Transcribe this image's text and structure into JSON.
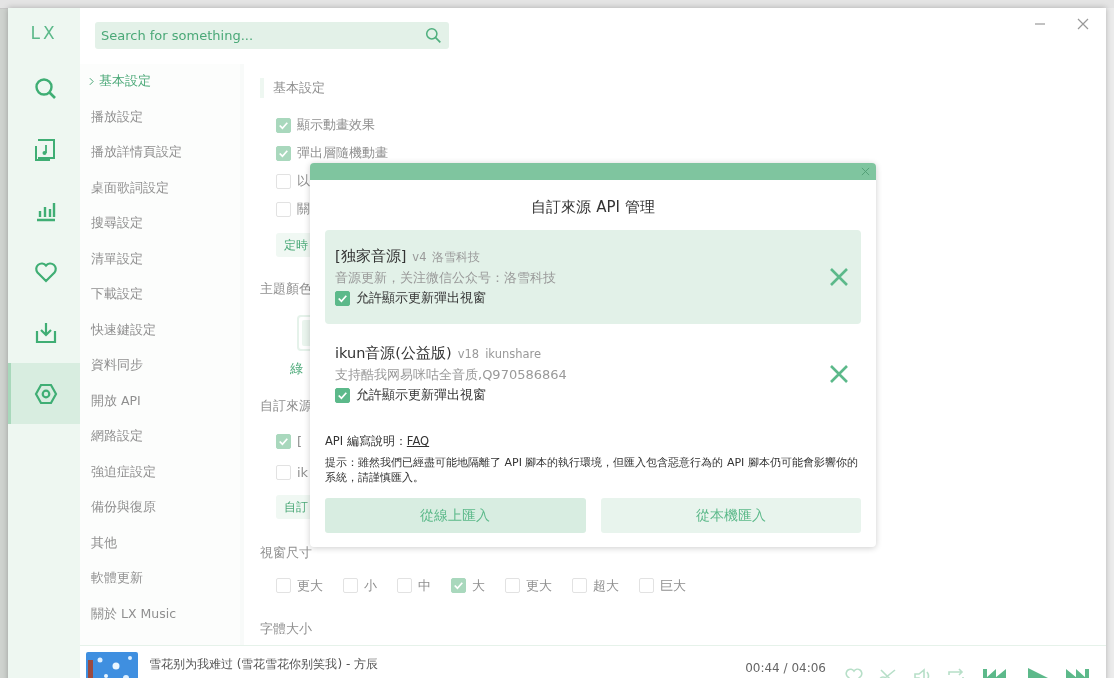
{
  "app": {
    "logo": "LX"
  },
  "sidebar": {
    "items": [
      {
        "selected": false
      },
      {
        "selected": false
      },
      {
        "selected": false
      },
      {
        "selected": false
      },
      {
        "selected": false
      },
      {
        "selected": true
      }
    ]
  },
  "search": {
    "placeholder": "Search for something..."
  },
  "settings_nav": {
    "items": [
      {
        "label": "基本設定",
        "selected": true
      },
      {
        "label": "播放設定",
        "selected": false
      },
      {
        "label": "播放詳情頁設定",
        "selected": false
      },
      {
        "label": "桌面歌詞設定",
        "selected": false
      },
      {
        "label": "搜尋設定",
        "selected": false
      },
      {
        "label": "清單設定",
        "selected": false
      },
      {
        "label": "下載設定",
        "selected": false
      },
      {
        "label": "快速鍵設定",
        "selected": false
      },
      {
        "label": "資料同步",
        "selected": false
      },
      {
        "label": "開放 API",
        "selected": false
      },
      {
        "label": "網路設定",
        "selected": false
      },
      {
        "label": "強迫症設定",
        "selected": false
      },
      {
        "label": "備份與復原",
        "selected": false
      },
      {
        "label": "其他",
        "selected": false
      },
      {
        "label": "軟體更新",
        "selected": false
      },
      {
        "label": "關於 LX Music",
        "selected": false
      }
    ]
  },
  "settings": {
    "heading": "基本設定",
    "basic_options": [
      {
        "label": "顯示動畫效果",
        "checked": true
      },
      {
        "label": "彈出層隨機動畫",
        "checked": true
      },
      {
        "label": "以",
        "checked": false
      },
      {
        "label": "關",
        "checked": false
      }
    ],
    "timer_button": "定時",
    "theme_label": "主題顏色",
    "theme_swatch_label": "綠",
    "custom_source_label": "自訂來源",
    "custom_sources": [
      {
        "label": "[",
        "checked": true
      },
      {
        "label": "ik",
        "checked": false
      }
    ],
    "custom_source_button": "自訂",
    "window_size_label": "視窗尺寸",
    "window_sizes": [
      {
        "label": "更大",
        "checked": false
      },
      {
        "label": "小",
        "checked": false
      },
      {
        "label": "中",
        "checked": false
      },
      {
        "label": "大",
        "checked": true
      },
      {
        "label": "更大",
        "checked": false
      },
      {
        "label": "超大",
        "checked": false
      },
      {
        "label": "巨大",
        "checked": false
      }
    ],
    "font_size_label": "字體大小"
  },
  "dialog": {
    "title": "自訂來源 API 管理",
    "sources": [
      {
        "name": "[独家音源]",
        "version": "v4",
        "author": "洛雪科技",
        "description": "音源更新，关注微信公众号：洛雪科技",
        "allow_label": "允許顯示更新彈出視窗",
        "allow_checked": true,
        "selected": true
      },
      {
        "name": "ikun音源(公益版)",
        "version": "v18",
        "author": "ikunshare",
        "description": "支持酷我网易咪咕全音质,Q970586864",
        "allow_label": "允許顯示更新彈出視窗",
        "allow_checked": true,
        "selected": false
      }
    ],
    "doc_label": "API 編寫說明：",
    "doc_link": "FAQ",
    "tip": "提示：雖然我們已經盡可能地隔離了 API 腳本的執行環境，但匯入包含惡意行為的 API 腳本仍可能會影響你的系統，請謹慎匯入。",
    "buttons": [
      {
        "label": "從線上匯入",
        "hovered": true
      },
      {
        "label": "從本機匯入",
        "hovered": false
      }
    ]
  },
  "player": {
    "title": "雪花别为我难过 (雪花雪花你别笑我) - 方辰",
    "time": "00:44 / 04:06"
  }
}
